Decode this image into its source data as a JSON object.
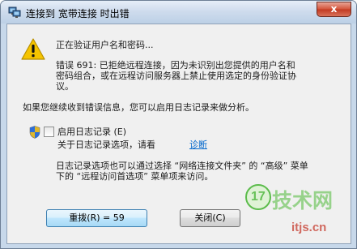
{
  "window": {
    "title": "连接到 宽带连接 时出错",
    "close_label": "x"
  },
  "messages": {
    "verifying": "正在验证用户名和密码...",
    "error_line1": "错误 691: 已拒绝远程连接，因为未识别出您提供的用户名和",
    "error_line2": "密码组合，或在远程访问服务器上禁止使用选定的身份验证协",
    "error_line3": "议。",
    "continue_hint": "如果您继续收到错误信息，您可以启用日志记录来做分析。"
  },
  "logging": {
    "checkbox_label": "启用日志记录 (E)",
    "checked": false,
    "about_text": "关于日志记录选项，请看",
    "diagnose_link": "诊断",
    "info_line1": "日志记录选项也可以通过选择 “网络连接文件夹” 的 “高级” 菜单",
    "info_line2": "下的 “远程访问首选项” 菜单项来访问。"
  },
  "buttons": {
    "redial": "重拨(R) = 59",
    "close": "关闭(C)"
  },
  "watermark": {
    "brand_number": "17",
    "brand_text": "技术网",
    "site": "itjs.cn"
  },
  "colors": {
    "warning": "#f5c400",
    "link": "#0066cc",
    "watermark_green": "#5cbc4c"
  }
}
